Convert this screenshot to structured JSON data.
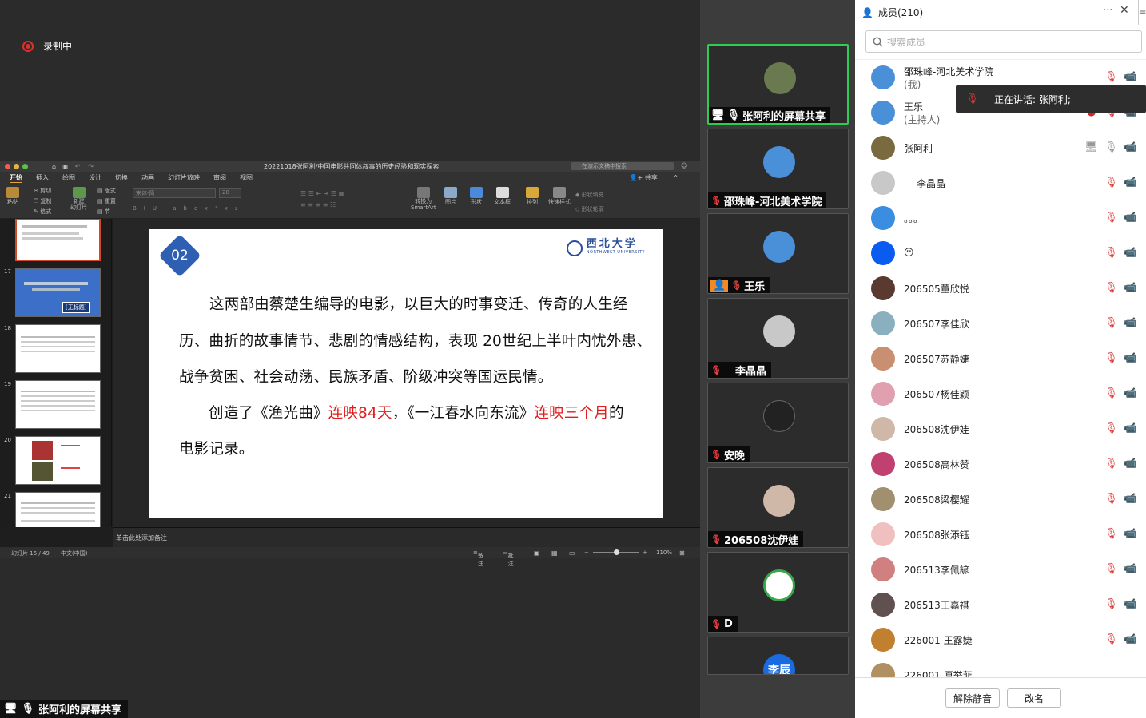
{
  "recording": {
    "label": "录制中"
  },
  "share_window": {
    "title": "20221018张阿利/中国电影共同体叙事的历史经验和现实探索",
    "search_placeholder": "在演示文稿中搜索",
    "share_label": "共享",
    "menu": [
      "开始",
      "插入",
      "绘图",
      "设计",
      "切换",
      "动画",
      "幻灯片放映",
      "审阅",
      "视图"
    ],
    "ribbon": {
      "paste": "粘贴",
      "cut": "剪切",
      "copy": "复制",
      "format": "格式",
      "new_slide": "新建\n幻灯片",
      "layout": "版式",
      "reset": "重置",
      "section": "节",
      "font_placeholder": "宋体-简",
      "font_size": "28",
      "smartart": "转换为\nSmartArt",
      "picture": "图片",
      "shape": "形状",
      "textbox": "文本框",
      "arrange": "排列",
      "quick_style": "快速样式",
      "shape_fill": "形状填充",
      "shape_outline": "形状轮廓"
    },
    "thumb_numbers": [
      "17",
      "18",
      "19",
      "20",
      "21"
    ],
    "thumb17_text": "[无标题]",
    "slide": {
      "badge": "02",
      "logo": "西北大学",
      "logo_sub": "NORTHWEST UNIVERSITY",
      "line1": "这两部由蔡楚生编导的电影，以巨大的时事变迁、传奇的人生经",
      "line2": "历、曲折的故事情节、悲剧的情感结构，表现 20世纪上半叶内忧外患、",
      "line3": "战争贫困、社会动荡、民族矛盾、阶级冲突等国运民情。",
      "line4a": "创造了《渔光曲》",
      "line4b": "连映84天",
      "line4c": "，《一江春水向东流》",
      "line4d": "连映三个月",
      "line4e": "的",
      "line5": "电影记录。"
    },
    "notes": "单击此处添加备注",
    "status": {
      "slide": "幻灯片 16 / 49",
      "lang": "中文(中国)",
      "notes": "备注",
      "comments": "批注",
      "zoom": "110%"
    }
  },
  "share_label": "张阿利的屏幕共享",
  "video_tiles": [
    {
      "name": "张阿利的屏幕共享"
    },
    {
      "name": "邵珠峰-河北美术学院"
    },
    {
      "name": "王乐"
    },
    {
      "name": "李晶晶"
    },
    {
      "name": "安晚"
    },
    {
      "name": "206508沈伊娃"
    },
    {
      "name": "D"
    },
    {
      "name": "李辰"
    }
  ],
  "panel": {
    "title": "成员(210)",
    "search_placeholder": "搜索成员",
    "tooltip": "正在讲话: 张阿利;",
    "members": [
      {
        "name": "邵珠峰-河北美术学院",
        "sub": "(我)",
        "color": "#4a90d9"
      },
      {
        "name": "王乐",
        "sub": "(主持人)",
        "color": "#4a90d9"
      },
      {
        "name": "张阿利",
        "sub": "",
        "color": "#7a6a40"
      },
      {
        "name": "李晶晶",
        "sub": "",
        "color": "#c8c8c8"
      },
      {
        "name": "。。。",
        "sub": "",
        "color": "#3a8de0"
      },
      {
        "name": "😶",
        "sub": "",
        "color": "#0a5cf0"
      },
      {
        "name": "206505董欣悦",
        "sub": "",
        "color": "#5a3a30"
      },
      {
        "name": "206507李佳欣",
        "sub": "",
        "color": "#8ab0c0"
      },
      {
        "name": "206507苏静婕",
        "sub": "",
        "color": "#c89070"
      },
      {
        "name": "206507杨佳颖",
        "sub": "",
        "color": "#e0a0b0"
      },
      {
        "name": "206508沈伊娃",
        "sub": "",
        "color": "#d0b8a8"
      },
      {
        "name": "206508高林赞",
        "sub": "",
        "color": "#c04070"
      },
      {
        "name": "206508梁樱耀",
        "sub": "",
        "color": "#a09070"
      },
      {
        "name": "206508张添钰",
        "sub": "",
        "color": "#f0c0c0"
      },
      {
        "name": "206513李佩諺",
        "sub": "",
        "color": "#d08080"
      },
      {
        "name": "206513王嘉祺",
        "sub": "",
        "color": "#605050"
      },
      {
        "name": "226001 王露婕",
        "sub": "",
        "color": "#c08030"
      },
      {
        "name": "226001 原举菲",
        "sub": "",
        "color": "#b09060"
      }
    ],
    "unmute_btn": "解除静音",
    "rename_btn": "改名"
  }
}
